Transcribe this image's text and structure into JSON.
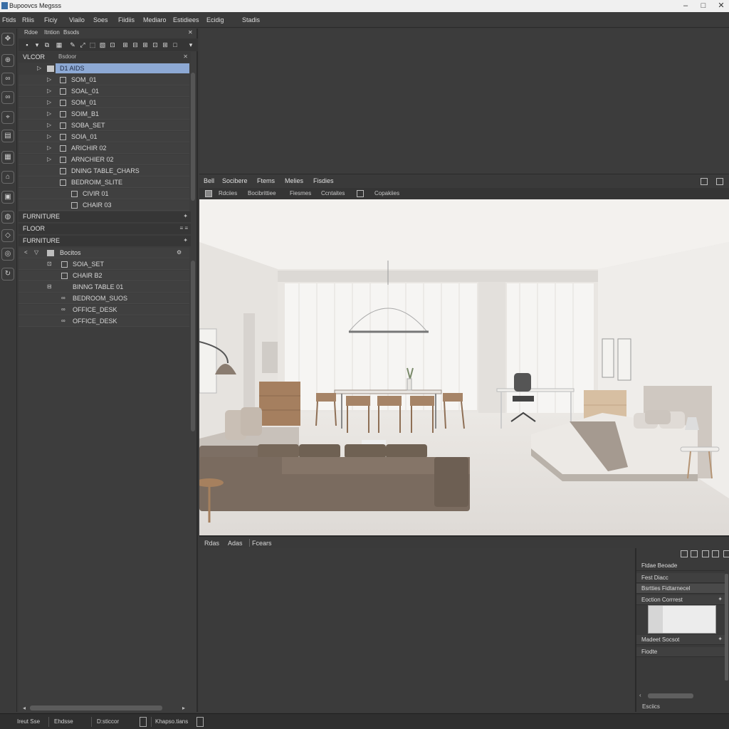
{
  "window": {
    "title": "Bupoovcs Megsss",
    "minimize": "–",
    "maximize": "□",
    "close": "✕"
  },
  "menu": [
    "Ftids",
    "Rliis",
    "Ficiy",
    "Viailo",
    "Soes",
    "Fiidiis",
    "Mediaro",
    "Estidiees",
    "Ecidig",
    "Stadis"
  ],
  "left_tools": [
    "move-icon",
    "select-icon",
    "link-icon",
    "link-icon",
    "measure-icon",
    "layers-icon",
    "grid-icon",
    "furniture-icon",
    "camera-icon",
    "paint-icon",
    "scale-icon",
    "globe-icon",
    "transform-icon"
  ],
  "outliner": {
    "tabs": [
      "Rdoe",
      "Itntion",
      "Bsods"
    ],
    "close": "✕",
    "pin": "✕",
    "header_left": "VLCOR",
    "header_right": "Bsdoor",
    "rows": [
      {
        "label": "D1 AIDS",
        "selected": true
      },
      {
        "label": "SOM_01"
      },
      {
        "label": "SOAL_01"
      },
      {
        "label": "SOM_01"
      },
      {
        "label": "SOIM_B1"
      },
      {
        "label": "SOBA_SET"
      },
      {
        "label": "SOIA_01"
      },
      {
        "label": "ARICHIR 02"
      },
      {
        "label": "ARNCHIER 02"
      },
      {
        "label": "DNING TABLE_CHARS"
      },
      {
        "label": "BEDROIM_SLITE"
      },
      {
        "label": "CIVIR 01"
      },
      {
        "label": "CHAIR 03"
      }
    ]
  },
  "sections": {
    "furniture1": "FURNITURE",
    "floor": "FLOOR",
    "furniture2": "FURNITURE",
    "floor_right": "≡ ≡"
  },
  "library": {
    "root": "Bocitos",
    "rows": [
      {
        "label": "SOIA_SET"
      },
      {
        "label": "CHAIR B2"
      },
      {
        "label": "BINNG TABLE 01"
      },
      {
        "label": "BEDROOM_SUOS"
      },
      {
        "label": "OFFICE_DESK"
      },
      {
        "label": "OFFICE_DESK"
      }
    ]
  },
  "viewport": {
    "tabs": [
      "Bell",
      "Socibere",
      "Ftems",
      "Melies",
      "Fisdies"
    ],
    "subtabs": [
      "Rdciies",
      "Bocibrittiee",
      "Fiesmes",
      "Ccntaites",
      "Copakiies"
    ]
  },
  "bottom": {
    "tabs": [
      "Rdas",
      "Adas",
      "Fcears"
    ]
  },
  "properties": {
    "title": "Ftdae Beoade",
    "rows": [
      "Fest Diacc",
      "Bsrtties Fidtarnecel",
      "Eoction Corrrest",
      "Madeet Socsot",
      "Fiodte"
    ],
    "footer": "Esciics"
  },
  "status": [
    "Ireut Sse",
    "Ehdsse",
    "D:sticcor",
    "Khapso.tians"
  ]
}
